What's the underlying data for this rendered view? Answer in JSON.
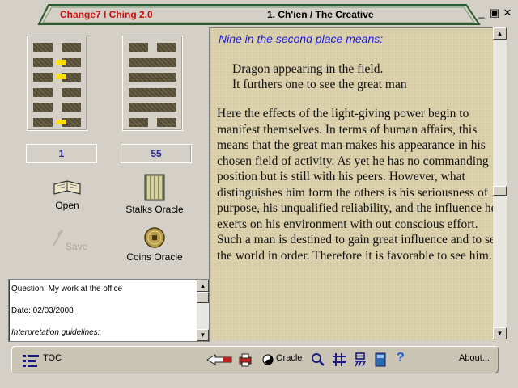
{
  "window": {
    "app_title": "Change7 I Ching 2.0",
    "section_title": "1. Ch'ien / The Creative",
    "controls": {
      "minimize": "_",
      "restore": "▣",
      "close": "✕"
    }
  },
  "hexagrams": [
    {
      "lines": [
        "broken",
        "broken",
        "broken",
        "broken",
        "broken",
        "broken"
      ],
      "changing_lines": [
        1,
        2,
        5
      ],
      "number": "1"
    },
    {
      "lines": [
        "broken",
        "solid",
        "solid",
        "solid",
        "solid",
        "broken"
      ],
      "changing_lines": [],
      "number": "55"
    }
  ],
  "tools": {
    "open": "Open",
    "stalks": "Stalks Oracle",
    "save": "Save",
    "coins": "Coins Oracle"
  },
  "notes": {
    "question": "Question: My work at the office",
    "date": "Date: 02/03/2008",
    "guidelines": "Interpretation guidelines:"
  },
  "reading": {
    "heading": "Nine in the second place means:",
    "verse_line1": "Dragon appearing in the field.",
    "verse_line2": "It furthers one to see the great man",
    "commentary": "Here the effects of the light-giving power begin to manifest themselves. In terms of human affairs, this means that the great man makes his appearance in his chosen field of activity. As yet he has no commanding position but is still with his peers. However, what distinguishes him form the others is his seriousness of purpose, his unqualified reliability, and the influence he exerts on his environment with out conscious effort. Such a man is destined to gain great influence and to set the world in order. Therefore it is favorable to see him."
  },
  "statusbar": {
    "toc": "TOC",
    "oracle": "Oracle",
    "about": "About...",
    "help": "?"
  },
  "colors": {
    "accent_red": "#cc1010",
    "heading_blue": "#1a1adc",
    "number_blue": "#2a2a90",
    "line_dark": "#5c5338",
    "changing_yellow": "#ffe000",
    "parchment": "#dcd1ad"
  }
}
